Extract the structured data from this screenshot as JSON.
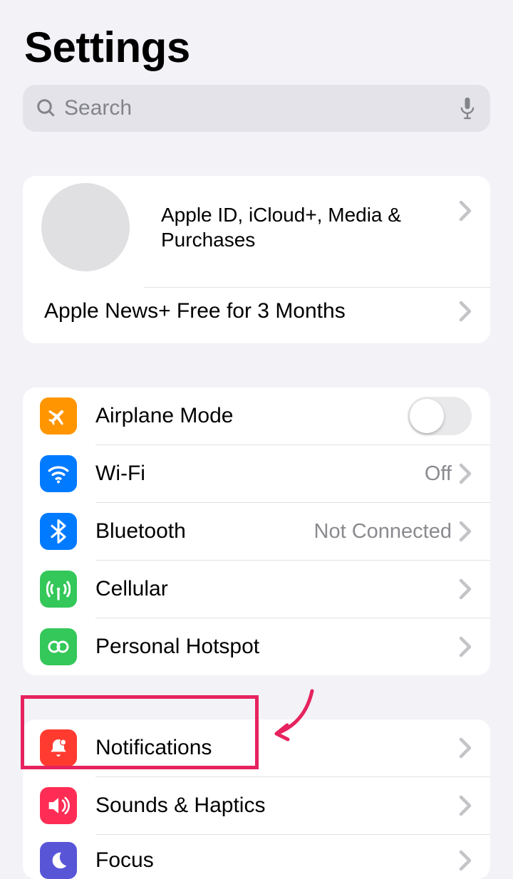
{
  "title": "Settings",
  "search": {
    "placeholder": "Search"
  },
  "account": {
    "subtitle": "Apple ID, iCloud+, Media & Purchases",
    "promo": "Apple News+ Free for 3 Months"
  },
  "group_network": {
    "airplane": {
      "label": "Airplane Mode",
      "toggle": false
    },
    "wifi": {
      "label": "Wi-Fi",
      "value": "Off"
    },
    "bluetooth": {
      "label": "Bluetooth",
      "value": "Not Connected"
    },
    "cellular": {
      "label": "Cellular"
    },
    "hotspot": {
      "label": "Personal Hotspot"
    }
  },
  "group_system": {
    "notifications": {
      "label": "Notifications"
    },
    "sounds": {
      "label": "Sounds & Haptics"
    },
    "focus": {
      "label": "Focus"
    }
  },
  "annotation": {
    "highlighted_item": "notifications"
  }
}
